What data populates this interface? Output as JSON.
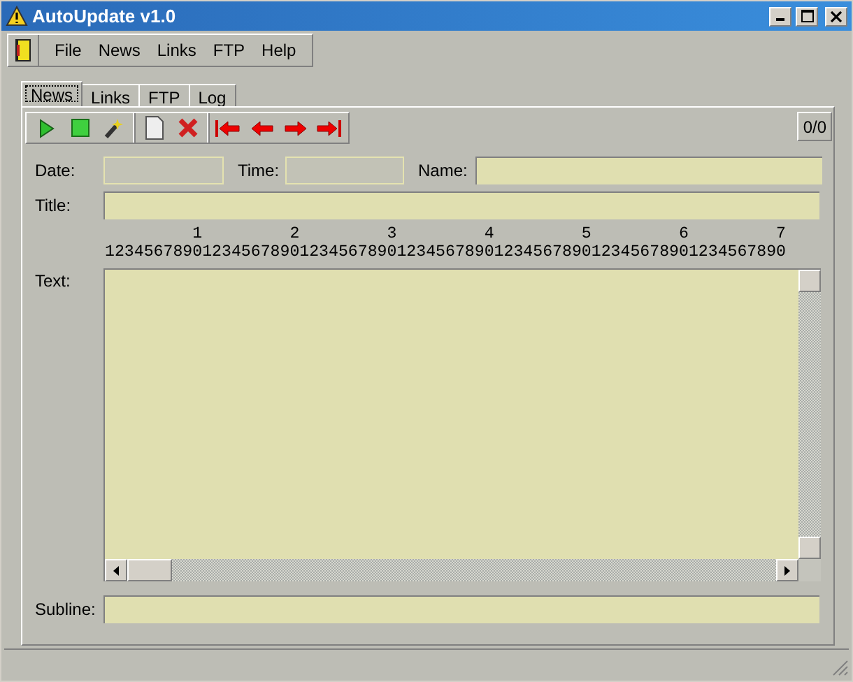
{
  "window": {
    "title": "AutoUpdate v1.0"
  },
  "menu": [
    "File",
    "News",
    "Links",
    "FTP",
    "Help"
  ],
  "tabs": [
    {
      "label": "News",
      "selected": true
    },
    {
      "label": "Links",
      "selected": false
    },
    {
      "label": "FTP",
      "selected": false
    },
    {
      "label": "Log",
      "selected": false
    }
  ],
  "toolbar": [
    [
      {
        "kind": "play"
      },
      {
        "kind": "stop"
      },
      {
        "kind": "wand"
      }
    ],
    [
      {
        "kind": "new"
      },
      {
        "kind": "delete"
      }
    ],
    [
      {
        "kind": "first"
      },
      {
        "kind": "prev"
      },
      {
        "kind": "next"
      },
      {
        "kind": "last"
      }
    ]
  ],
  "counter": "0/0",
  "fields": {
    "date": {
      "label": "Date:",
      "disabled": true
    },
    "time": {
      "label": "Time:",
      "disabled": true
    },
    "name": {
      "label": "Name:",
      "disabled": false
    },
    "title": {
      "label": "Title:",
      "disabled": false
    }
  },
  "ruler": {
    "tens": "         1         2         3         4         5         6         7",
    "units": "1234567890123456789012345678901234567890123456789012345678901234567890"
  },
  "text": {
    "label": "Text:"
  },
  "subline": {
    "label": "Subline:"
  }
}
